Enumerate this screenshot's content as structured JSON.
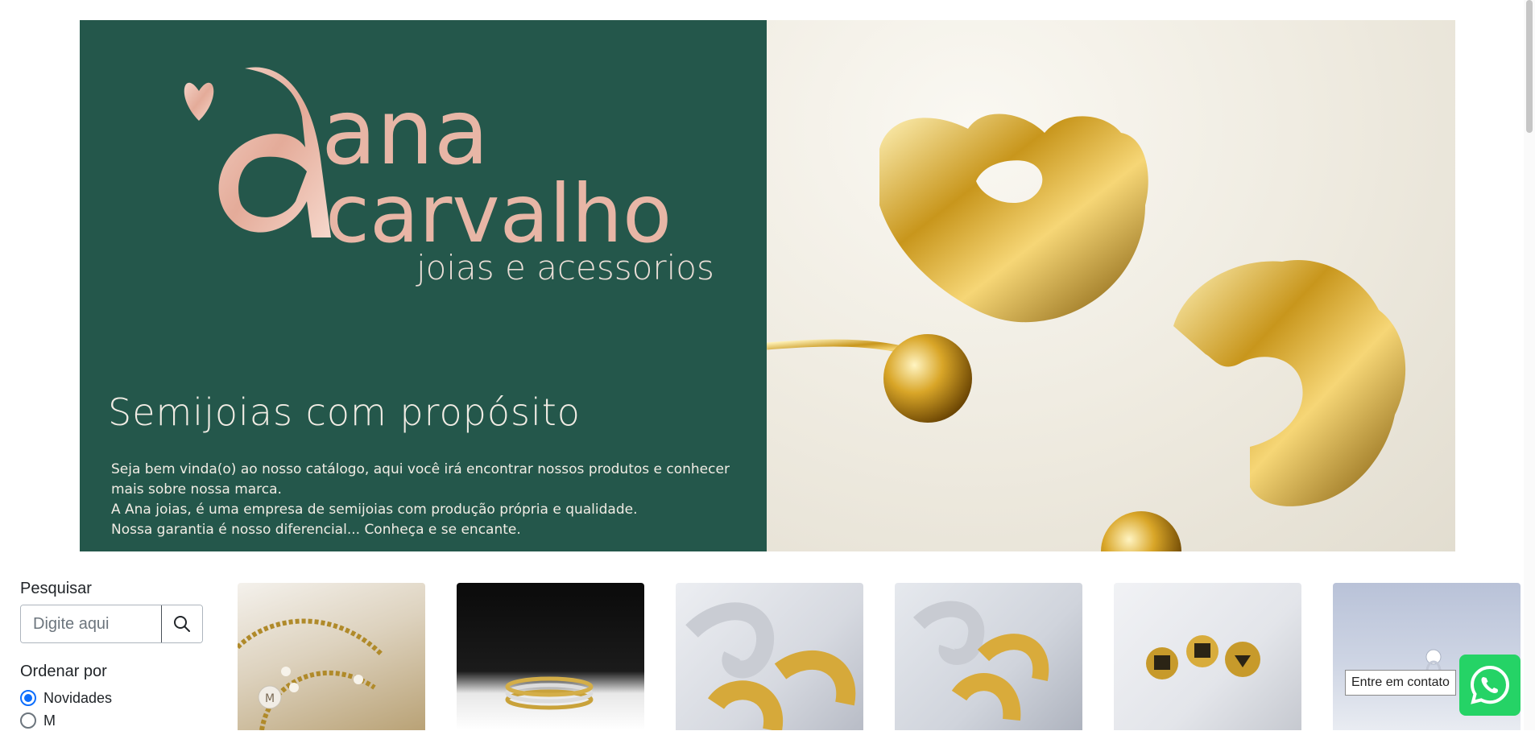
{
  "banner": {
    "logo_word1": "ana",
    "logo_word2": "carvalho",
    "logo_subtitle": "joias e acessorios",
    "tagline": "Semijoias com propósito",
    "intro_lines": [
      "Seja bem vinda(o) ao nosso catálogo, aqui você irá encontrar nossos produtos e conhecer mais sobre nossa marca.",
      "A Ana joias, é uma empresa de semijoias com produção própria e qualidade.",
      "Nossa garantia é nosso diferencial... Conheça e se encante."
    ],
    "colors": {
      "panel": "#24574b",
      "logo": "#e8b6a6"
    }
  },
  "sidebar": {
    "search_label": "Pesquisar",
    "search_placeholder": "Digite aqui",
    "search_icon": "search-icon",
    "order_label": "Ordenar por",
    "order_options": [
      {
        "label": "Novidades",
        "checked": true
      },
      {
        "label": "M",
        "checked": false
      }
    ]
  },
  "products": [
    {
      "image": "pearl-bracelets-with-letter-charm"
    },
    {
      "image": "stacked-gold-rings-on-black"
    },
    {
      "image": "silver-and-gold-hoop-earrings"
    },
    {
      "image": "silver-and-gold-hoop-earrings"
    },
    {
      "image": "gold-signet-rings"
    },
    {
      "image": "solitaire-ring-on-blue"
    }
  ],
  "contact": {
    "tooltip": "Entre em contato",
    "whatsapp_icon": "whatsapp-icon",
    "color": "#25d366"
  }
}
